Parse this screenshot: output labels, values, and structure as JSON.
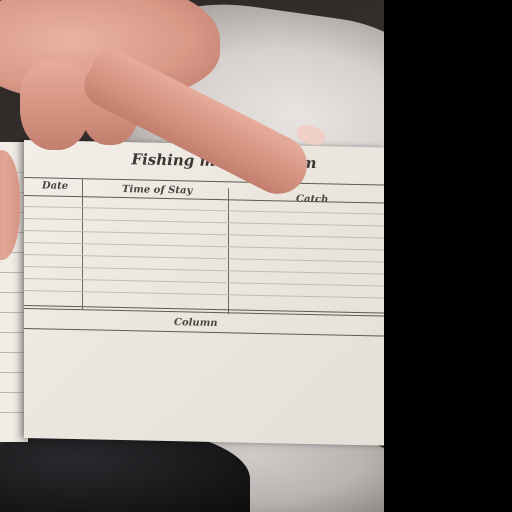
{
  "memorandum": {
    "title": "Fishing memorandum",
    "columns": [
      "Date",
      "Time of Stay",
      "Catch"
    ],
    "footer_label": "Column"
  },
  "colors": {
    "paper": "#efeae3",
    "ink": "#3a3633",
    "skin": "#dca08f",
    "background_cloth": "#d6d1cf"
  }
}
